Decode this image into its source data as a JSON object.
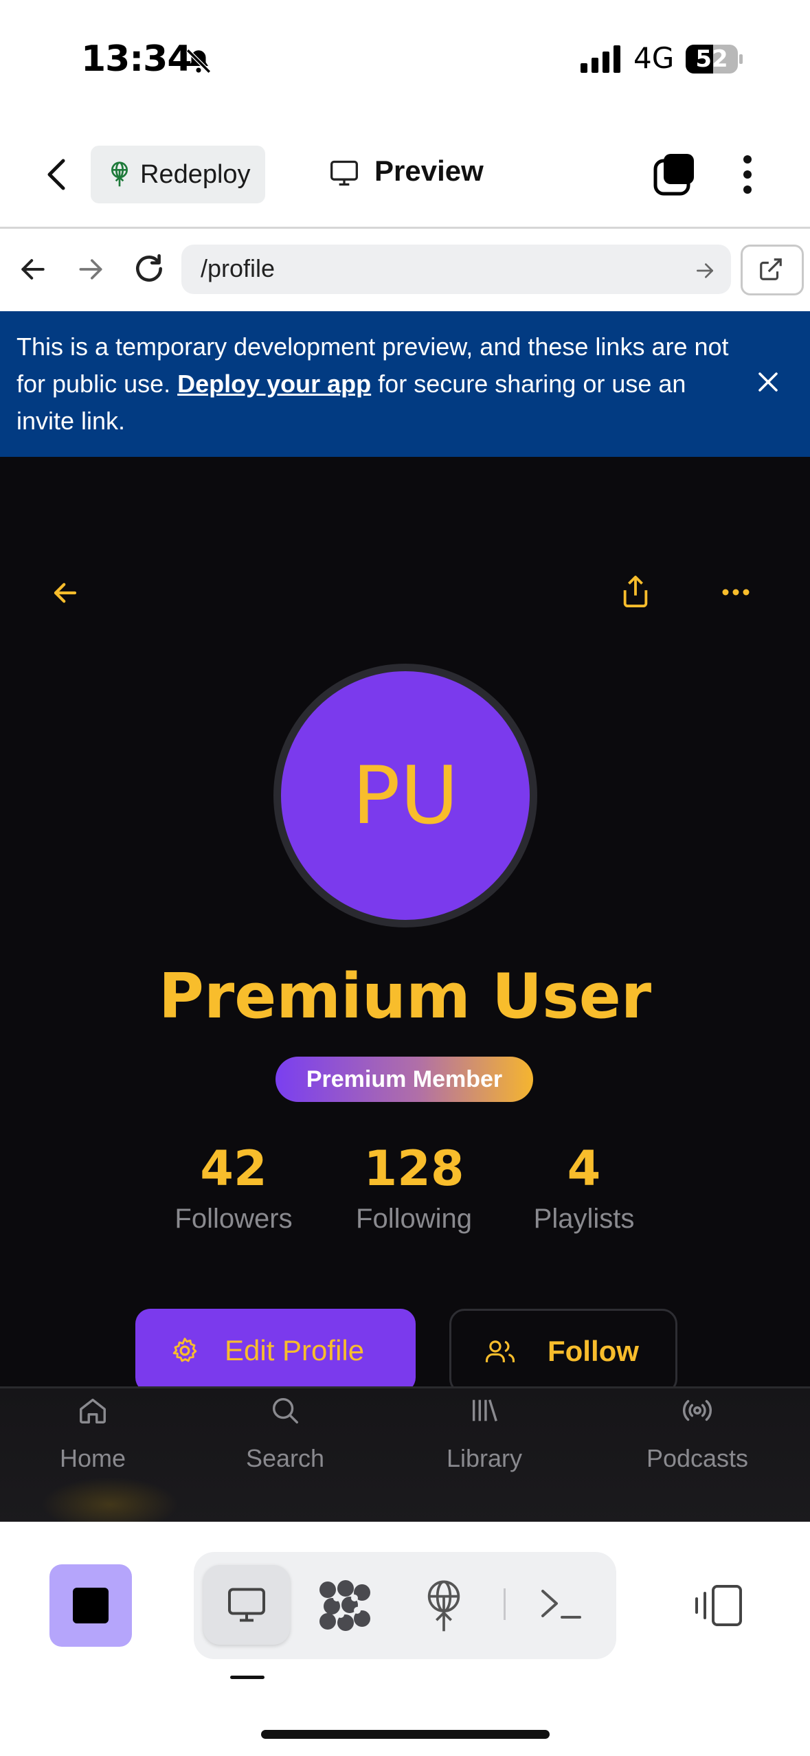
{
  "status": {
    "time": "13:34",
    "network": "4G",
    "battery": "52"
  },
  "toolbar": {
    "redeploy_label": "Redeploy",
    "preview_label": "Preview"
  },
  "browser": {
    "url": "/profile"
  },
  "banner": {
    "text_before": "This is a temporary development preview, and these links are not for public use. ",
    "link": "Deploy your app",
    "text_after": " for secure sharing or use an invite link."
  },
  "profile": {
    "initials": "PU",
    "name": "Premium User",
    "badge": "Premium Member",
    "stats": [
      {
        "value": "42",
        "label": "Followers"
      },
      {
        "value": "128",
        "label": "Following"
      },
      {
        "value": "4",
        "label": "Playlists"
      }
    ],
    "edit_label": "Edit Profile",
    "follow_label": "Follow"
  },
  "nav": [
    {
      "label": "Home",
      "icon": "home-icon"
    },
    {
      "label": "Search",
      "icon": "search-icon"
    },
    {
      "label": "Library",
      "icon": "library-icon"
    },
    {
      "label": "Podcasts",
      "icon": "podcast-icon"
    }
  ],
  "colors": {
    "accent": "#f8bd2c",
    "purple": "#7b3aed",
    "banner": "#023b82",
    "app_bg": "#0b0a0d"
  }
}
